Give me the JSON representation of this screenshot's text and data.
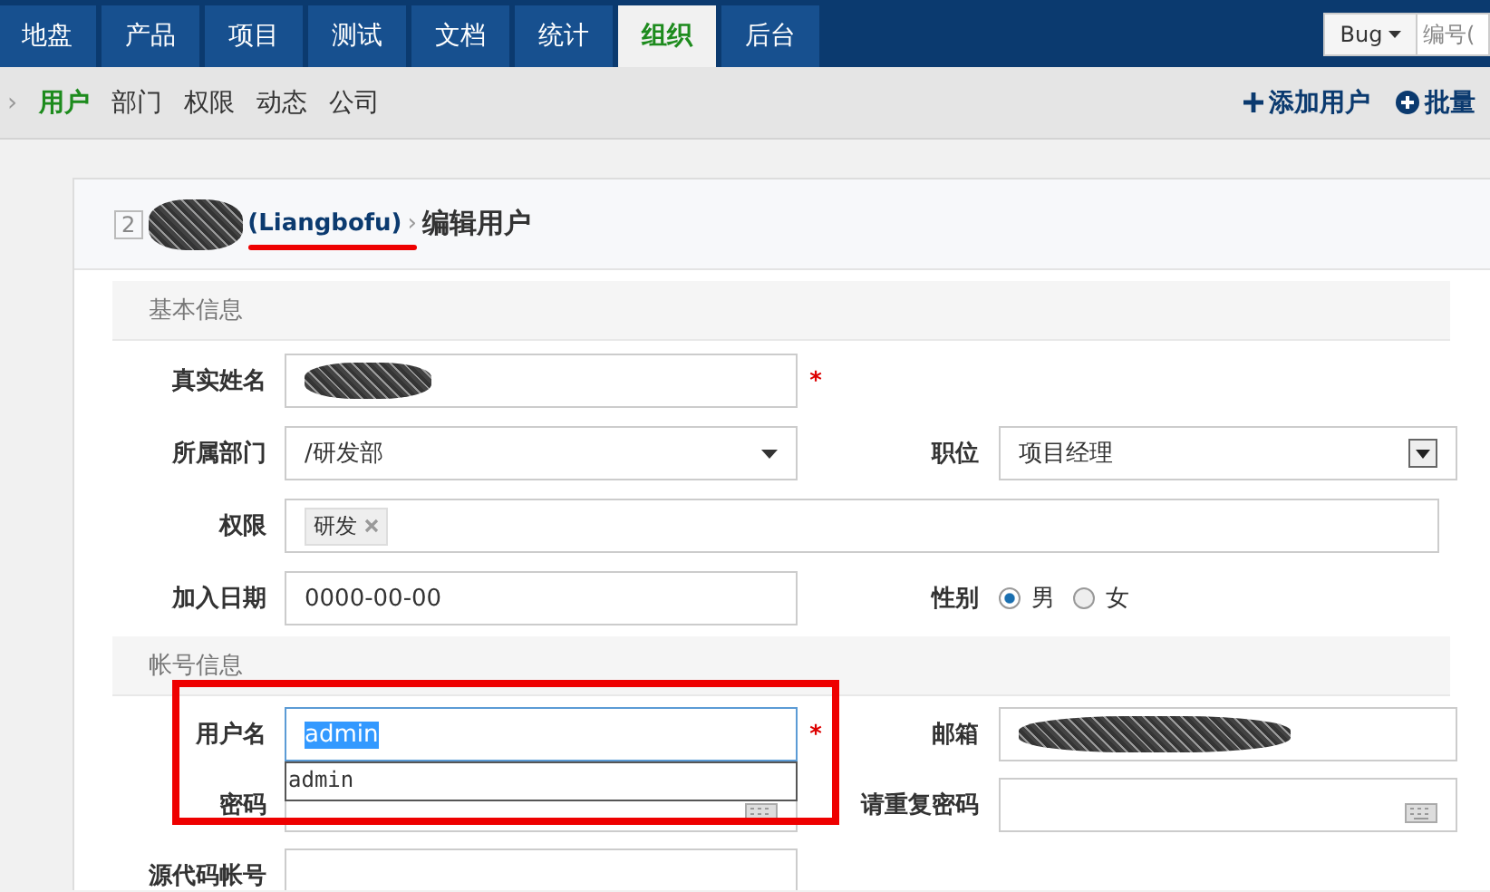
{
  "nav": {
    "tabs": [
      {
        "label": "地盘",
        "selected": false
      },
      {
        "label": "产品",
        "selected": false
      },
      {
        "label": "项目",
        "selected": false
      },
      {
        "label": "测试",
        "selected": false
      },
      {
        "label": "文档",
        "selected": false
      },
      {
        "label": "统计",
        "selected": false
      },
      {
        "label": "组织",
        "selected": true
      },
      {
        "label": "后台",
        "selected": false
      }
    ],
    "type_select": "Bug",
    "search": {
      "placeholder": "编号("
    }
  },
  "subnav": {
    "crumb": "›",
    "items": [
      {
        "label": "用户",
        "selected": true
      },
      {
        "label": "部门",
        "selected": false
      },
      {
        "label": "权限",
        "selected": false
      },
      {
        "label": "动态",
        "selected": false
      },
      {
        "label": "公司",
        "selected": false
      }
    ],
    "actions": [
      {
        "kind": "add",
        "label": "添加用户"
      },
      {
        "kind": "batch",
        "label": "批量"
      }
    ]
  },
  "header": {
    "index": "2",
    "account": "(Liangbofu)",
    "separator": "›",
    "title": "编辑用户"
  },
  "required_mark": "*",
  "sections": [
    {
      "title": "基本信息",
      "rows": [
        [
          {
            "kind": "text",
            "label": "真实姓名",
            "redacted": true,
            "required": true
          }
        ],
        [
          {
            "kind": "select",
            "label": "所属部门",
            "value": "/研发部"
          },
          {
            "kind": "combo",
            "label": "职位",
            "value": "项目经理"
          }
        ],
        [
          {
            "kind": "tags",
            "label": "权限",
            "tags": [
              "研发"
            ]
          }
        ],
        [
          {
            "kind": "text",
            "label": "加入日期",
            "value": "0000-00-00"
          },
          {
            "kind": "radio",
            "label": "性别",
            "options": [
              {
                "label": "男",
                "selected": true
              },
              {
                "label": "女",
                "selected": false
              }
            ]
          }
        ]
      ]
    },
    {
      "title": "帐号信息",
      "rows": [
        [
          {
            "kind": "text",
            "label": "用户名",
            "value": "admin",
            "focused": true,
            "required": true,
            "suggestions": [
              "admin"
            ]
          },
          {
            "kind": "text",
            "label": "邮箱",
            "redacted": true
          }
        ],
        [
          {
            "kind": "password",
            "label": "密码"
          },
          {
            "kind": "password",
            "label": "请重复密码"
          }
        ],
        [
          {
            "kind": "text",
            "label": "源代码帐号"
          }
        ]
      ]
    }
  ]
}
